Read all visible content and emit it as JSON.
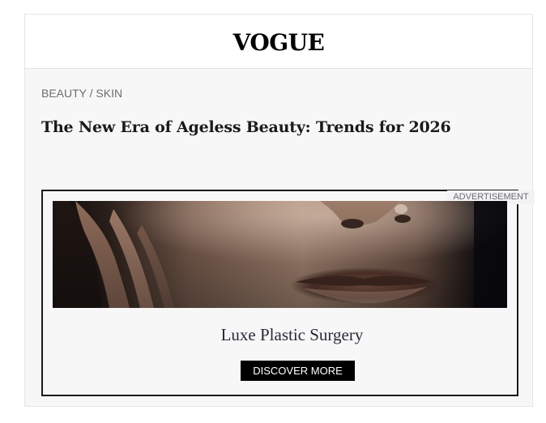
{
  "masthead": {
    "logo": "VOGUE"
  },
  "article": {
    "breadcrumb": "BEAUTY / SKIN",
    "headline": "The New Era of Ageless Beauty: Trends for 2026"
  },
  "ad": {
    "label": "ADVERTISEMENT",
    "brand": "Luxe Plastic Surgery",
    "cta_label": "DISCOVER MORE"
  },
  "colors": {
    "page_background": "#f7f7f7",
    "masthead_background": "#ffffff",
    "cta_background": "#000000",
    "cta_text": "#ffffff"
  }
}
